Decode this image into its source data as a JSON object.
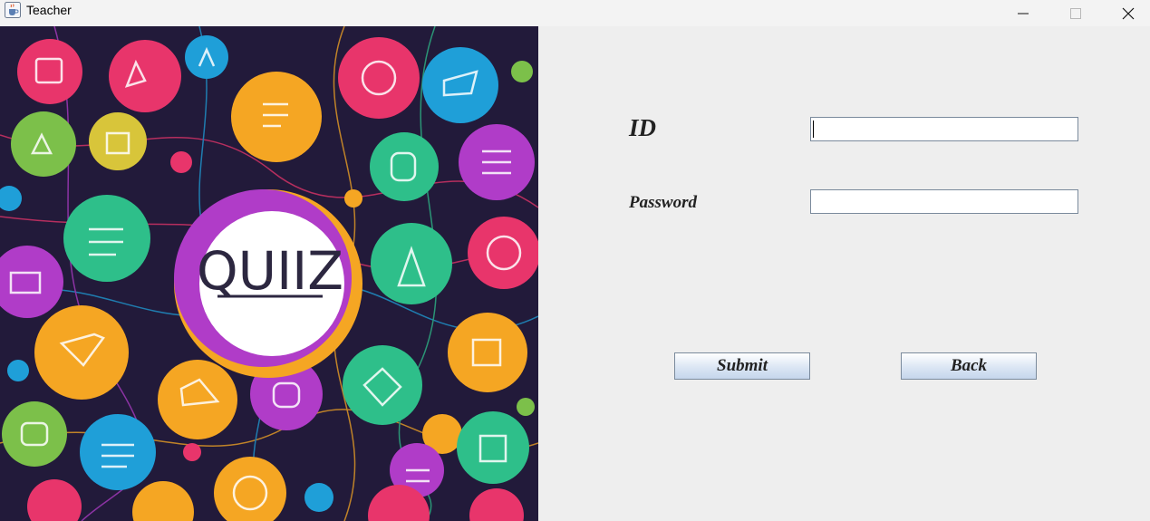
{
  "window": {
    "title": "Teacher",
    "icon": "java-coffee-cup-icon",
    "controls": [
      "minimize-icon",
      "maximize-icon",
      "close-icon"
    ]
  },
  "illustration": {
    "center_text": "QUIIZ",
    "colors": {
      "background": "#221a3a",
      "pink": "#e8356b",
      "blue": "#1f9fd8",
      "orange": "#f5a623",
      "green": "#2ebf8a",
      "purple": "#b03cc8",
      "lime": "#7cc04a"
    }
  },
  "form": {
    "id_label": "ID",
    "id_value": "",
    "password_label": "Password",
    "password_value": "",
    "submit_label": "Submit",
    "back_label": "Back"
  }
}
